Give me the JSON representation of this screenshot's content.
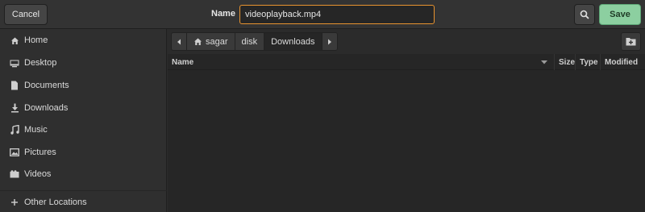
{
  "header": {
    "cancel_label": "Cancel",
    "name_label": "Name",
    "filename_value": "videoplayback.mp4",
    "save_label": "Save",
    "accent_color": "#e8932f",
    "save_color": "#8ccfa0"
  },
  "sidebar": {
    "items": [
      {
        "label": "Home",
        "icon": "home-icon"
      },
      {
        "label": "Desktop",
        "icon": "desktop-icon"
      },
      {
        "label": "Documents",
        "icon": "document-icon"
      },
      {
        "label": "Downloads",
        "icon": "download-icon"
      },
      {
        "label": "Music",
        "icon": "music-icon"
      },
      {
        "label": "Pictures",
        "icon": "picture-icon"
      },
      {
        "label": "Videos",
        "icon": "video-icon"
      },
      {
        "label": "Other Locations",
        "icon": "plus-icon"
      }
    ]
  },
  "pathbar": {
    "segments": [
      "sagar",
      "disk",
      "Downloads"
    ]
  },
  "filelist": {
    "columns": [
      "Name",
      "Size",
      "Type",
      "Modified"
    ]
  }
}
